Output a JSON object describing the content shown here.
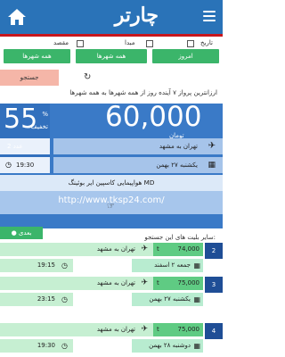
{
  "header": {
    "logo": "چارتر",
    "logo_color": "#2a73b8",
    "accent": "#c8161d"
  },
  "filters": {
    "labels": {
      "date": "تاریخ",
      "origin": "مبدا",
      "destination": "مقصد"
    },
    "buttons": {
      "date": "امروز",
      "origin": "همه شهرها",
      "destination": "همه شهرها"
    },
    "search": "جستجو",
    "headline": "ارزانترین پرواز ۷ آینده روز از همه شهرها به همه شهرها"
  },
  "deal": {
    "discount": "55",
    "percent_sign": "%",
    "discount_label": "تخفیف",
    "price": "60,000",
    "currency": "تومان",
    "route": "تهران به مشهد",
    "seats": "2 عدد",
    "date": "یکشنبه ۲۷ بهمن",
    "time": "19:30",
    "airline": "هواپیمایی کاسپین ایر بوئینگ MD",
    "url": "http://www.tksp24.com/"
  },
  "next_button": "بعدی",
  "others_label": "سایر بلیت های این جستجو:",
  "flights": [
    {
      "index": "2",
      "price": "74,000",
      "currency": "t",
      "route": "تهران به مشهد",
      "date": "جمعه ۲ اسفند",
      "time": "19:15"
    },
    {
      "index": "3",
      "price": "75,000",
      "currency": "t",
      "route": "تهران به مشهد",
      "date": "یکشنبه ۲۷ بهمن",
      "time": "23:15"
    },
    {
      "index": "4",
      "price": "75,000",
      "currency": "t",
      "route": "تهران به مشهد",
      "date": "دوشنبه ۲۸ بهمن",
      "time": "19:30"
    }
  ]
}
